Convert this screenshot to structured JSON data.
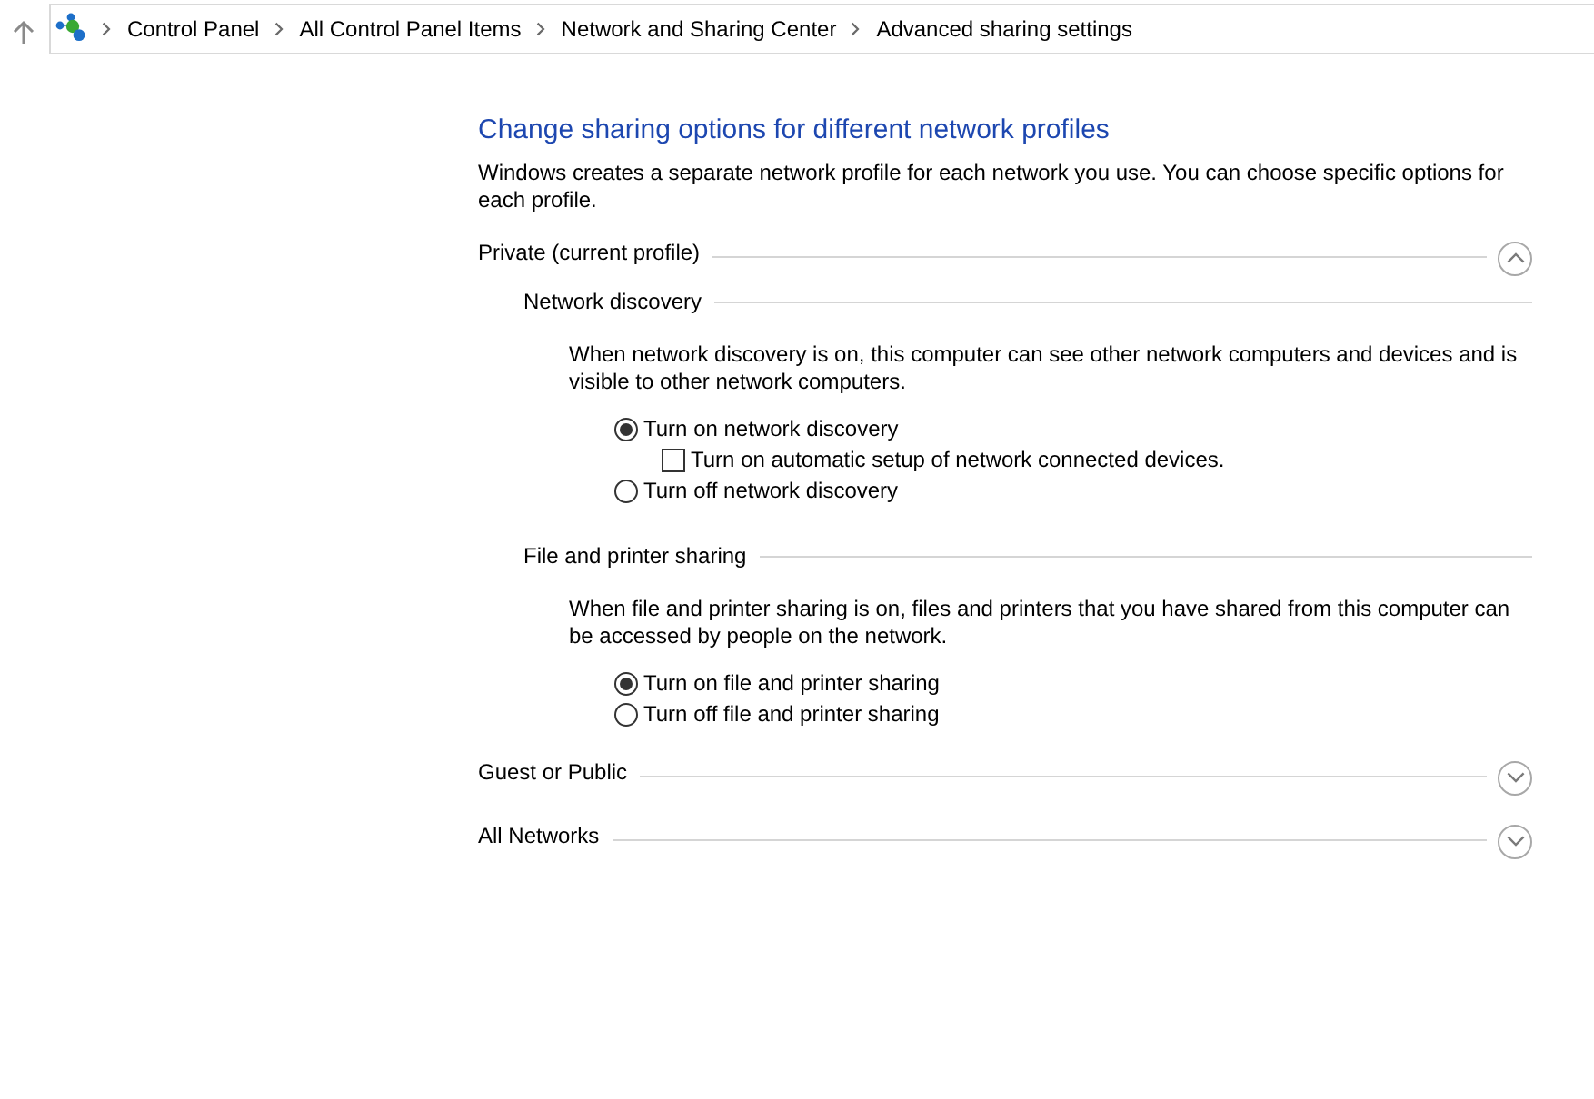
{
  "nav": {
    "breadcrumbs": [
      "Control Panel",
      "All Control Panel Items",
      "Network and Sharing Center",
      "Advanced sharing settings"
    ]
  },
  "heading": "Change sharing options for different network profiles",
  "description": "Windows creates a separate network profile for each network you use. You can choose specific options for each profile.",
  "profiles": [
    {
      "title": "Private (current profile)",
      "expanded": true,
      "sections": [
        {
          "title": "Network discovery",
          "description": "When network discovery is on, this computer can see other network computers and devices and is visible to other network computers.",
          "options": [
            {
              "kind": "radio",
              "label": "Turn on network discovery",
              "selected": true,
              "children": [
                {
                  "kind": "checkbox",
                  "label": "Turn on automatic setup of network connected devices.",
                  "checked": false
                }
              ]
            },
            {
              "kind": "radio",
              "label": "Turn off network discovery",
              "selected": false
            }
          ]
        },
        {
          "title": "File and printer sharing",
          "description": "When file and printer sharing is on, files and printers that you have shared from this computer can be accessed by people on the network.",
          "options": [
            {
              "kind": "radio",
              "label": "Turn on file and printer sharing",
              "selected": true
            },
            {
              "kind": "radio",
              "label": "Turn off file and printer sharing",
              "selected": false
            }
          ]
        }
      ]
    },
    {
      "title": "Guest or Public",
      "expanded": false
    },
    {
      "title": "All Networks",
      "expanded": false
    }
  ]
}
